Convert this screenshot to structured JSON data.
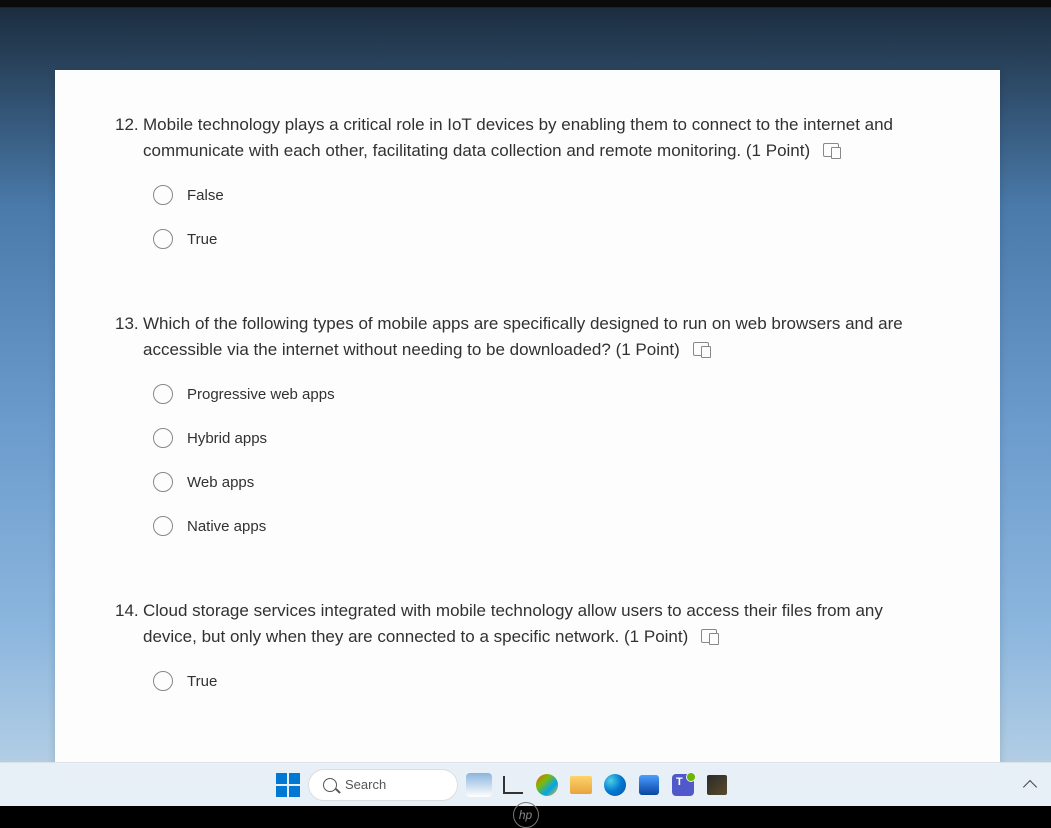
{
  "questions": [
    {
      "number": "12.",
      "text": "Mobile technology plays a critical role in IoT devices by enabling them to connect to the internet and communicate with each other, facilitating data collection and remote monitoring.",
      "points": "(1 Point)",
      "options": [
        "False",
        "True"
      ]
    },
    {
      "number": "13.",
      "text": "Which of the following types of mobile apps are specifically designed to run on web browsers and are accessible via the internet without needing to be downloaded?",
      "points": "(1 Point)",
      "options": [
        "Progressive web apps",
        "Hybrid apps",
        "Web apps",
        "Native apps"
      ]
    },
    {
      "number": "14.",
      "text": "Cloud storage services integrated with mobile technology allow users to access their files from any device, but only when they are connected to a specific network.",
      "points": "(1 Point)",
      "options": [
        "True"
      ]
    }
  ],
  "taskbar": {
    "search_placeholder": "Search"
  },
  "laptop_brand": "hp"
}
